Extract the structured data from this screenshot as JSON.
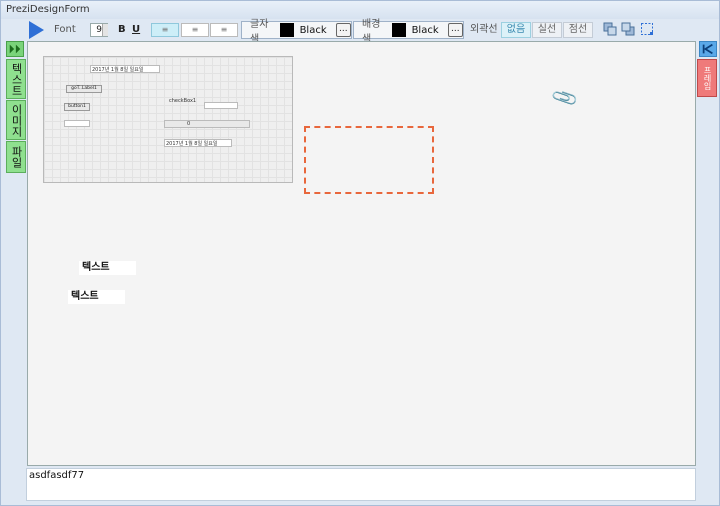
{
  "window": {
    "title": "PreziDesignForm"
  },
  "toolbar": {
    "font_label": "Font",
    "font_size": "9",
    "bold": "B",
    "underline": "U",
    "align_left": "≡",
    "align_center": "≡",
    "align_right": "≡",
    "text_color_label": "글자색",
    "text_color_name": "Black",
    "text_color_more": "...",
    "bg_color_label": "배경색",
    "bg_color_name": "Black",
    "bg_color_more": "...",
    "border_label": "외곽선",
    "border_none": "없음",
    "border_solid": "실선",
    "border_dotted": "점선",
    "text_color": "#000000",
    "bg_color": "#000000"
  },
  "left_tabs": [
    "텍스트",
    "이미지",
    "파일"
  ],
  "right_tab": "프레임",
  "form_preview": {
    "date1": "2017년  1월  8일 일요일",
    "label1": "goT..Label1",
    "button1": "button1",
    "checkbox1": "checkBox1",
    "progress_value": "0",
    "date2": "2017년  1월  8일 일요일"
  },
  "canvas_texts": [
    {
      "text": "텍스트"
    },
    {
      "text": "텍스트"
    }
  ],
  "bottom_text": "asdfasdf77"
}
